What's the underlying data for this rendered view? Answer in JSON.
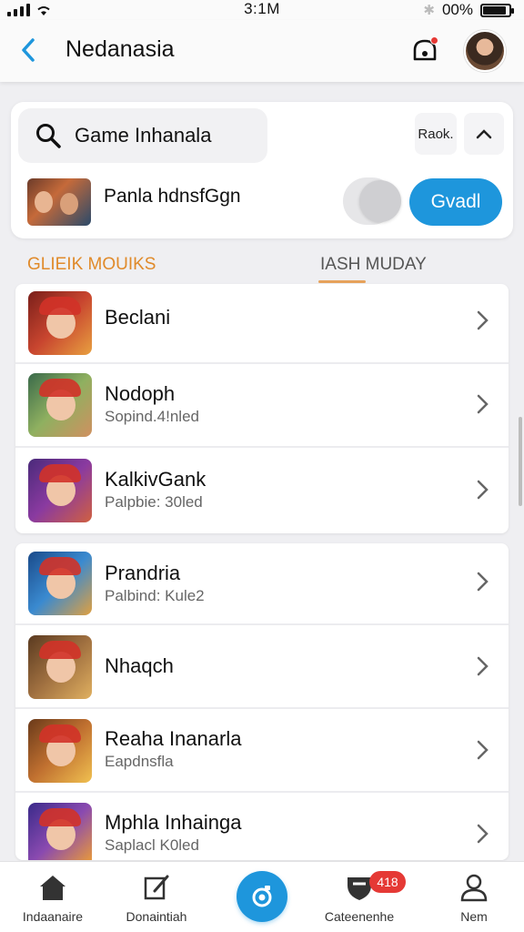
{
  "status_bar": {
    "time": "3:1M",
    "battery_text": "00%",
    "battery_level": 0.9
  },
  "header": {
    "title": "Nedanasia"
  },
  "search": {
    "value": "Game Inhanala",
    "sort_label": "Raok."
  },
  "featured": {
    "name": "Panla hdnsfGgn",
    "action_label": "Gvadl"
  },
  "tabs": [
    {
      "label": "GLIEIK MOUIKS"
    },
    {
      "label": "IASH MUDAY"
    }
  ],
  "list_a": [
    {
      "title": "Beclani",
      "subtitle": ""
    },
    {
      "title": "Nodoph",
      "subtitle": "Sopind.4!nled"
    },
    {
      "title": "KalkivGank",
      "subtitle": "Palpbie: 30led"
    }
  ],
  "list_b": [
    {
      "title": "Prandria",
      "subtitle": "Palbind: Kule2"
    },
    {
      "title": "Nhaqch",
      "subtitle": ""
    },
    {
      "title": "Reaha Inanarla",
      "subtitle": "Eapdnsfla"
    },
    {
      "title": "Mphla Inhainga",
      "subtitle": "Saplacl K0led"
    }
  ],
  "bottom_nav": [
    {
      "label": "Indaanaire",
      "icon": "home-icon"
    },
    {
      "label": "Donaintiah",
      "icon": "edit-icon"
    },
    {
      "label": "",
      "icon": "camera-icon"
    },
    {
      "label": "Cateenenhe",
      "icon": "shield-icon",
      "badge": "418"
    },
    {
      "label": "Nem",
      "icon": "person-icon"
    }
  ],
  "colors": {
    "accent": "#1e96dc",
    "tab_active": "#e08a2a",
    "badge": "#e53935"
  }
}
